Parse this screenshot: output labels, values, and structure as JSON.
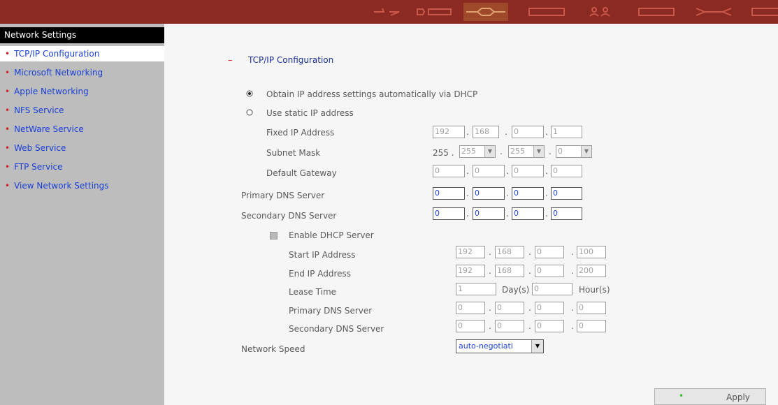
{
  "sidebar": {
    "title": "Network Settings",
    "items": [
      {
        "label": "TCP/IP Configuration"
      },
      {
        "label": "Microsoft Networking"
      },
      {
        "label": "Apple Networking"
      },
      {
        "label": "NFS Service"
      },
      {
        "label": "NetWare Service"
      },
      {
        "label": "Web Service"
      },
      {
        "label": "FTP Service"
      },
      {
        "label": "View Network Settings"
      }
    ]
  },
  "section": {
    "collapse_sign": "–",
    "title": "TCP/IP Configuration"
  },
  "ip_mode": {
    "dhcp_label": "Obtain IP address settings automatically via DHCP",
    "static_label": "Use static IP address",
    "selected": "dhcp"
  },
  "static": {
    "fixed_ip_label": "Fixed IP Address",
    "fixed_ip": [
      "192",
      "168",
      "0",
      "1"
    ],
    "subnet_label": "Subnet Mask",
    "subnet_prefix": "255 .",
    "subnet": [
      "255",
      "255",
      "0"
    ],
    "gateway_label": "Default Gateway",
    "gateway": [
      "0",
      "0",
      "0",
      "0"
    ]
  },
  "dns": {
    "primary_label": "Primary DNS Server",
    "primary": [
      "0",
      "0",
      "0",
      "0"
    ],
    "secondary_label": "Secondary DNS Server",
    "secondary": [
      "0",
      "0",
      "0",
      "0"
    ]
  },
  "dhcp_server": {
    "enable_label": "Enable DHCP Server",
    "start_label": "Start IP Address",
    "start": [
      "192",
      "168",
      "0",
      "100"
    ],
    "end_label": "End IP Address",
    "end": [
      "192",
      "168",
      "0",
      "200"
    ],
    "lease_label": "Lease Time",
    "lease_days": "1",
    "days_unit": "Day(s)",
    "lease_hours": "0",
    "hours_unit": "Hour(s)",
    "primary_label": "Primary DNS Server",
    "primary": [
      "0",
      "0",
      "0",
      "0"
    ],
    "secondary_label": "Secondary DNS Server",
    "secondary": [
      "0",
      "0",
      "0",
      "0"
    ]
  },
  "speed": {
    "label": "Network Speed",
    "value": "auto-negotiati"
  },
  "apply": {
    "label": "Apply"
  },
  "colors": {
    "topbar": "#8b2a22",
    "sidebar": "#bdbdbd",
    "link": "#1a3fd6",
    "bullet": "#d11e1e",
    "status_dot": "#2fbf2f"
  }
}
